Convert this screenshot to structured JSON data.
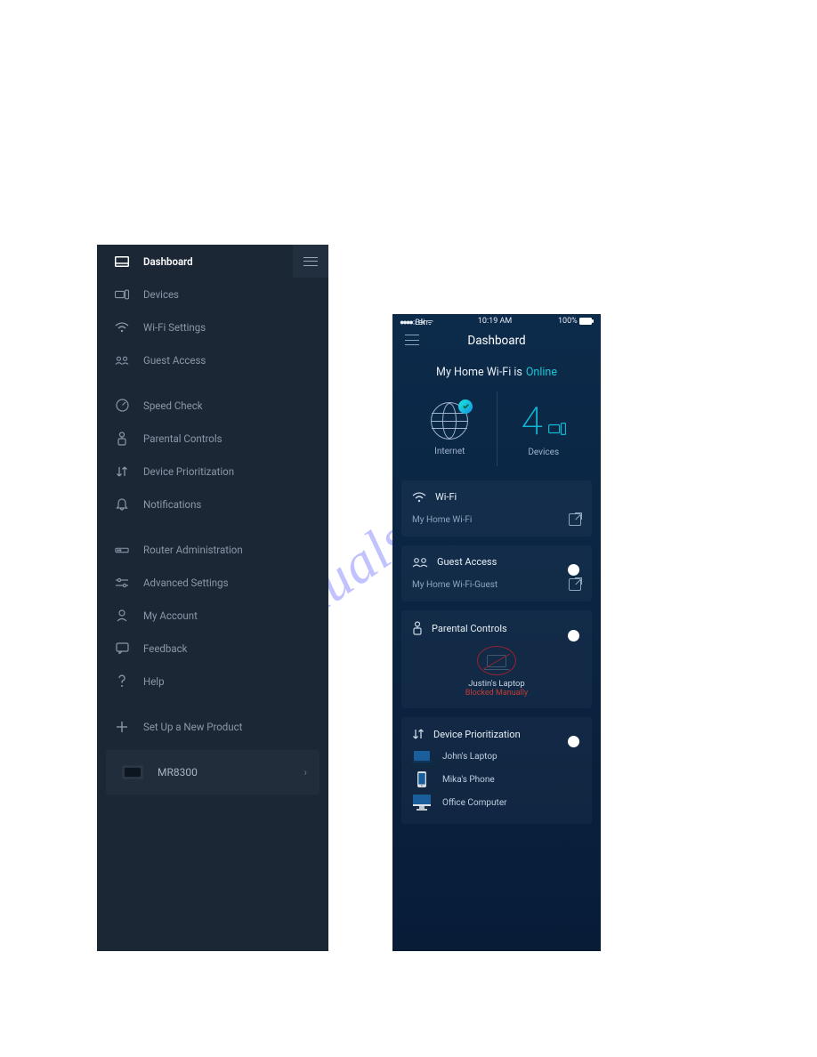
{
  "watermark": "manualshive.com",
  "sidebar": {
    "items": [
      {
        "label": "Dashboard",
        "active": true
      },
      {
        "label": "Devices"
      },
      {
        "label": "Wi-Fi Settings"
      },
      {
        "label": "Guest Access"
      },
      {
        "label": "Speed Check"
      },
      {
        "label": "Parental Controls"
      },
      {
        "label": "Device Prioritization"
      },
      {
        "label": "Notifications"
      },
      {
        "label": "Router Administration"
      },
      {
        "label": "Advanced Settings"
      },
      {
        "label": "My Account"
      },
      {
        "label": "Feedback"
      },
      {
        "label": "Help"
      },
      {
        "label": "Set Up a New Product"
      }
    ],
    "device": {
      "name": "MR8300"
    }
  },
  "phone": {
    "status": {
      "carrier": "●●●●○ Belkin ᯤ",
      "time": "10:19 AM",
      "battery": "100%"
    },
    "title": "Dashboard",
    "subtitle": {
      "prefix": "My Home Wi-Fi is",
      "status": "Online"
    },
    "internet_label": "Internet",
    "devices_count": "4",
    "devices_label": "Devices",
    "wifi": {
      "title": "Wi-Fi",
      "name": "My Home Wi-Fi"
    },
    "guest": {
      "title": "Guest Access",
      "name": "My Home Wi-Fi-Guest"
    },
    "parental": {
      "title": "Parental Controls",
      "device": "Justin's Laptop",
      "state": "Blocked Manually"
    },
    "prioritization": {
      "title": "Device Prioritization",
      "items": [
        {
          "label": "John's Laptop"
        },
        {
          "label": "Mika's Phone"
        },
        {
          "label": "Office Computer"
        }
      ]
    }
  }
}
